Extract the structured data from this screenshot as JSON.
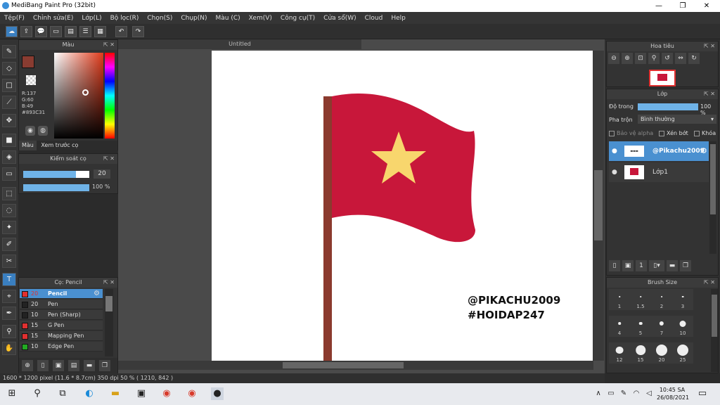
{
  "window": {
    "title": "MediBang Paint Pro (32bit)",
    "min": "—",
    "max": "❐",
    "close": "✕"
  },
  "menu": [
    "Tệp(F)",
    "Chỉnh sửa(E)",
    "Lớp(L)",
    "Bộ lọc(R)",
    "Chọn(S)",
    "Chụp(N)",
    "Màu (C)",
    "Xem(V)",
    "Công cụ(T)",
    "Cửa sổ(W)",
    "Cloud",
    "Help"
  ],
  "color_panel": {
    "title": "Màu",
    "r": "R:137",
    "g": "G:60",
    "b": "B:49",
    "hex": "#893C31",
    "tab_color": "Màu",
    "tab_preview": "Xem trước cọ",
    "main_color": "#893C31"
  },
  "brush_control": {
    "title": "Kiểm soát cọ",
    "size_value": "20",
    "opacity_value": "100 %",
    "size_level": 0.8,
    "opacity_level": 1.0
  },
  "brush_list": {
    "title": "Cọ: Pencil",
    "items": [
      {
        "size": "20",
        "name": "Pencil",
        "color": "#e03030"
      },
      {
        "size": "20",
        "name": "Pen",
        "color": "#222222"
      },
      {
        "size": "10",
        "name": "Pen (Sharp)",
        "color": "#222222"
      },
      {
        "size": "15",
        "name": "G Pen",
        "color": "#e03030"
      },
      {
        "size": "15",
        "name": "Mapping Pen",
        "color": "#e03030"
      },
      {
        "size": "10",
        "name": "Edge Pen",
        "color": "#22aa22"
      }
    ]
  },
  "canvas": {
    "tab": "Untitled",
    "watermark1": "@PIKACHU2009",
    "watermark2": "#HOIDAP247",
    "flag_red": "#c8173a",
    "star_yellow": "#f8d66d",
    "pole": "#8b3a2e"
  },
  "status": {
    "text": "1600 * 1200 pixel   (11.6 * 8.7cm)   350 dpi   50 %   ( 1210, 842 )"
  },
  "navigator": {
    "title": "Hoa tiêu"
  },
  "layer_panel": {
    "title": "Lớp",
    "opacity_label": "Độ trong",
    "opacity_value": "100 %",
    "opacity_level": 1.0,
    "blend_label": "Pha trộn",
    "blend_value": "Bình thường",
    "protect_alpha": "Bảo vệ alpha",
    "clipping": "Xén bớt",
    "lock": "Khóa",
    "layers": [
      {
        "name": "@Pikachu2009",
        "selected": true
      },
      {
        "name": "Lớp1",
        "selected": false
      }
    ]
  },
  "brush_size": {
    "title": "Brush Size",
    "sizes": [
      "1",
      "1.5",
      "2",
      "3",
      "4",
      "5",
      "7",
      "10",
      "12",
      "15",
      "20",
      "25"
    ]
  },
  "taskbar": {
    "time": "10:45 SA",
    "date": "26/08/2021"
  }
}
